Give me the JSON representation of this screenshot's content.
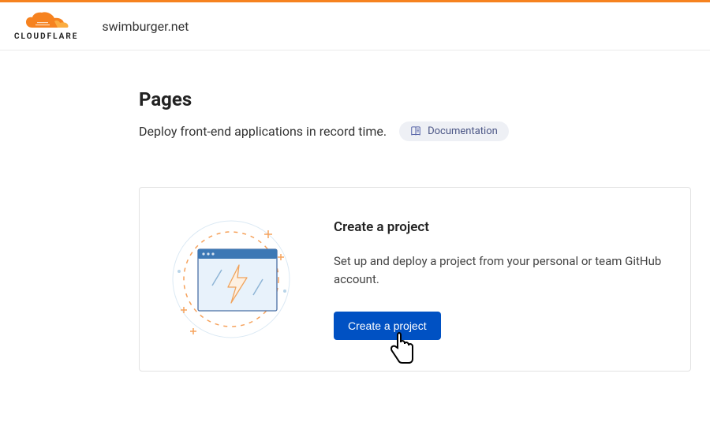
{
  "header": {
    "brand": "CLOUDFLARE",
    "domain": "swimburger.net"
  },
  "page": {
    "title": "Pages",
    "subtitle": "Deploy front-end applications in record time.",
    "doc_link_label": "Documentation"
  },
  "card": {
    "title": "Create a project",
    "description": "Set up and deploy a project from your personal or team GitHub account.",
    "button_label": "Create a project"
  }
}
